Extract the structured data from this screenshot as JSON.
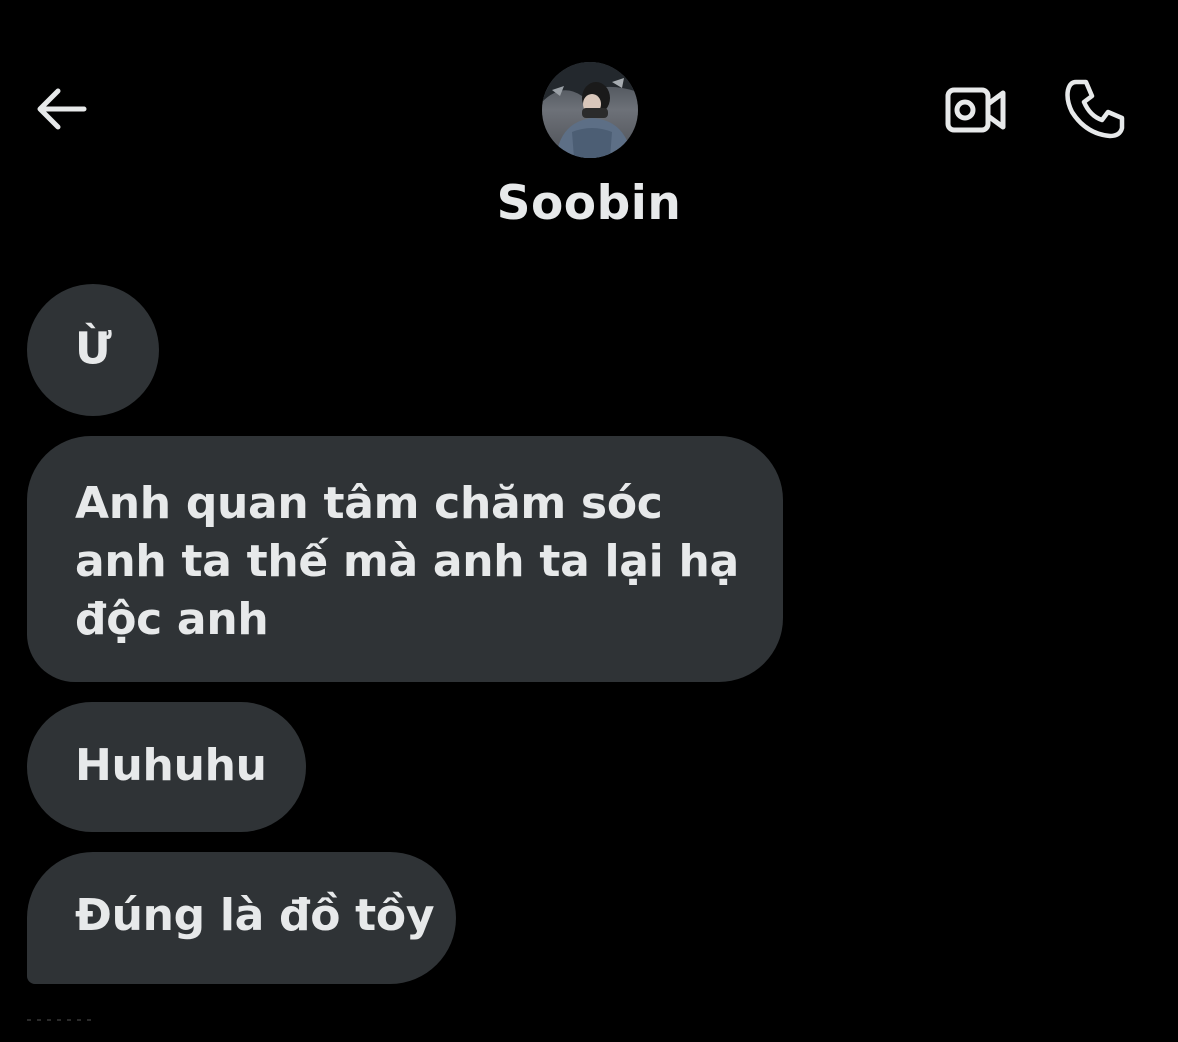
{
  "header": {
    "contact_name": "Soobin",
    "back_icon": "arrow-left-icon",
    "video_icon": "video-camera-icon",
    "call_icon": "phone-icon"
  },
  "messages": [
    {
      "text": "Ừ"
    },
    {
      "text": "Anh quan tâm chăm sóc anh ta thế mà anh ta lại hạ độc anh"
    },
    {
      "text": "Huhuhu"
    },
    {
      "text": "Đúng là đồ tồy"
    }
  ],
  "colors": {
    "background": "#000000",
    "bubble": "#2f3336",
    "text": "#e7e9ea"
  }
}
